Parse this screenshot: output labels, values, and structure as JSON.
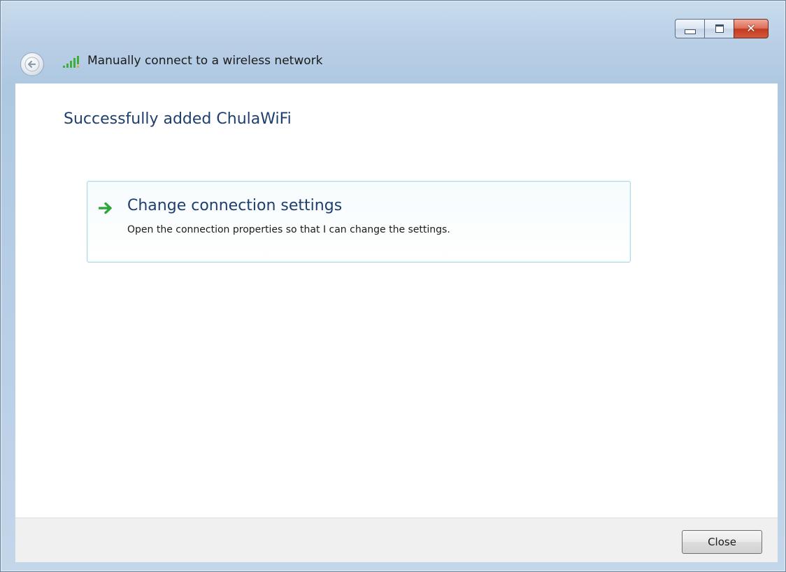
{
  "window": {
    "title": "Manually connect to a wireless network",
    "caption_buttons": {
      "minimize_icon": "minimize-icon",
      "maximize_icon": "maximize-icon",
      "close_icon": "close-icon",
      "close_glyph": "✕"
    }
  },
  "icons": {
    "back": "back-arrow-icon",
    "wifi": "wifi-signal-icon",
    "link_arrow": "green-arrow-icon"
  },
  "content": {
    "heading": "Successfully added ChulaWiFi",
    "command_link": {
      "title": "Change connection settings",
      "description": "Open the connection properties so that I can change the settings."
    }
  },
  "footer": {
    "close_label": "Close"
  },
  "colors": {
    "heading_blue": "#1e3f6e",
    "link_border": "#a6dbe9",
    "arrow_green": "#2fa63a",
    "close_red": "#c43a1f"
  }
}
